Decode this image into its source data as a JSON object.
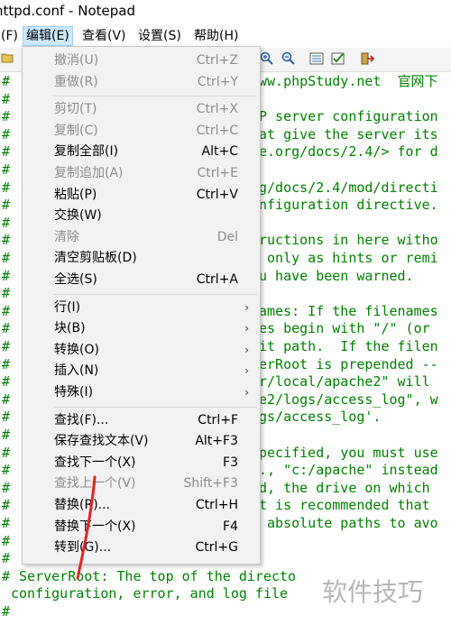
{
  "window": {
    "title": "httpd.conf - Notepad"
  },
  "menubar": {
    "items": [
      {
        "label": "(F)",
        "active": false
      },
      {
        "label": "编辑(E)",
        "active": true
      },
      {
        "label": "查看(V)",
        "active": false
      },
      {
        "label": "设置(S)",
        "active": false
      },
      {
        "label": "帮助(H)",
        "active": false
      }
    ]
  },
  "editor": {
    "lines": [
      {
        "hash": "#",
        "text": "ww.phpStudy.net  官网下"
      },
      {
        "hash": "#",
        "text": ""
      },
      {
        "hash": "#",
        "text": "P server configuration"
      },
      {
        "hash": "#",
        "text": "at give the server its"
      },
      {
        "hash": "#",
        "text": "e.org/docs/2.4/> for d"
      },
      {
        "hash": "#",
        "text": ""
      },
      {
        "hash": "#",
        "text": "g/docs/2.4/mod/directi"
      },
      {
        "hash": "#",
        "text": "nfiguration directive."
      },
      {
        "hash": "#",
        "text": ""
      },
      {
        "hash": "#",
        "text": "ructions in here witho"
      },
      {
        "hash": "#",
        "text": " only as hints or remi"
      },
      {
        "hash": "#",
        "text": "u have been warned."
      },
      {
        "hash": "#",
        "text": ""
      },
      {
        "hash": "#",
        "text": "ames: If the filenames"
      },
      {
        "hash": "#",
        "text": "es begin with \"/\" (or"
      },
      {
        "hash": "#",
        "text": "it path.  If the filen"
      },
      {
        "hash": "#",
        "text": "erRoot is prepended --"
      },
      {
        "hash": "#",
        "text": "r/local/apache2\" will"
      },
      {
        "hash": "#",
        "text": "e2/logs/access_log\", w"
      },
      {
        "hash": "#",
        "text": "gs/access_log'."
      },
      {
        "hash": "#",
        "text": ""
      },
      {
        "hash": "#",
        "text": "pecified, you must use"
      },
      {
        "hash": "#",
        "text": "., \"c:/apache\" instead"
      },
      {
        "hash": "#",
        "text": "d, the drive on which"
      },
      {
        "hash": "#",
        "text": "t is recommended that"
      },
      {
        "hash": "#",
        "text": " absolute paths to avo"
      },
      {
        "hash": "#",
        "text": ""
      },
      {
        "hash": "#",
        "text": ""
      },
      {
        "hash": "#",
        "text": " ServerRoot: The top of the directo"
      },
      {
        "hash": "",
        "text": "configuration, error, and log file"
      },
      {
        "hash": "#",
        "text": ""
      }
    ]
  },
  "edit_menu": {
    "items": [
      {
        "label": "撤消(U)",
        "accel": "Ctrl+Z",
        "enabled": false
      },
      {
        "label": "重做(R)",
        "accel": "Ctrl+Y",
        "enabled": false
      },
      {
        "label": "剪切(T)",
        "accel": "Ctrl+X",
        "enabled": false
      },
      {
        "label": "复制(C)",
        "accel": "Ctrl+C",
        "enabled": false
      },
      {
        "label": "复制全部(I)",
        "accel": "Alt+C",
        "enabled": true
      },
      {
        "label": "复制追加(A)",
        "accel": "Ctrl+E",
        "enabled": false
      },
      {
        "label": "粘贴(P)",
        "accel": "Ctrl+V",
        "enabled": true
      },
      {
        "label": "交换(W)",
        "accel": "",
        "enabled": true
      },
      {
        "label": "清除",
        "accel": "Del",
        "enabled": false
      },
      {
        "label": "清空剪贴板(D)",
        "accel": "",
        "enabled": true
      },
      {
        "label": "全选(S)",
        "accel": "Ctrl+A",
        "enabled": true
      },
      {
        "label": "行(I)",
        "accel": "",
        "enabled": true,
        "submenu": true
      },
      {
        "label": "块(B)",
        "accel": "",
        "enabled": true,
        "submenu": true
      },
      {
        "label": "转换(O)",
        "accel": "",
        "enabled": true,
        "submenu": true
      },
      {
        "label": "插入(N)",
        "accel": "",
        "enabled": true,
        "submenu": true
      },
      {
        "label": "特殊(I)",
        "accel": "",
        "enabled": true,
        "submenu": true
      },
      {
        "label": "查找(F)...",
        "accel": "Ctrl+F",
        "enabled": true
      },
      {
        "label": "保存查找文本(V)",
        "accel": "Alt+F3",
        "enabled": true
      },
      {
        "label": "查找下一个(X)",
        "accel": "F3",
        "enabled": true
      },
      {
        "label": "查找上一个(V)",
        "accel": "Shift+F3",
        "enabled": false
      },
      {
        "label": "替换(R)...",
        "accel": "Ctrl+H",
        "enabled": true
      },
      {
        "label": "替换下一个(X)",
        "accel": "F4",
        "enabled": true
      },
      {
        "label": "转到(G)...",
        "accel": "Ctrl+G",
        "enabled": true
      }
    ]
  },
  "watermark": {
    "text": "软件技巧"
  },
  "colors": {
    "comment": "#008000",
    "menu_bg": "#f2f2f2",
    "highlight": "#cce8ff"
  }
}
